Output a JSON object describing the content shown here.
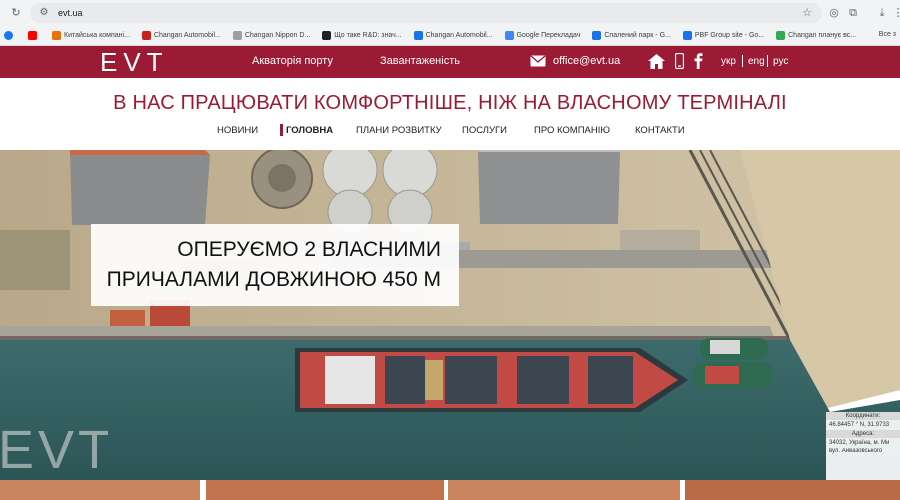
{
  "browser": {
    "url": "evt.ua",
    "bookmarks": [
      {
        "label": "Китайська компані...",
        "color": "#e8710a"
      },
      {
        "label": "Changan Automobil...",
        "color": "#c5221f"
      },
      {
        "label": "Changan Nippon D...",
        "color": "#9aa0a6"
      },
      {
        "label": "Що таке R&D: знач...",
        "color": "#202124"
      },
      {
        "label": "Changan Automobil...",
        "color": "#1a73e8"
      },
      {
        "label": "Google Перекладач",
        "color": "#4285f4"
      },
      {
        "label": "Спалений парк - G...",
        "color": "#1a73e8"
      },
      {
        "label": "PBF Group site - Go...",
        "color": "#1a73e8"
      },
      {
        "label": "Changan планує вс...",
        "color": "#34a853"
      }
    ],
    "bookmarks_more": "Все з"
  },
  "header": {
    "logo_text": "EVT",
    "nav": [
      "Акваторія порту",
      "Завантаженість"
    ],
    "email": "office@evt.ua",
    "languages": [
      "укр",
      "eng",
      "рус"
    ],
    "brand_color": "#9c1b34"
  },
  "slogan": "В НАС ПРАЦЮВАТИ КОМФОРТНІШЕ, НІЖ НА ВЛАСНОМУ ТЕРМІНАЛІ",
  "main_nav": [
    {
      "label": "НОВИНИ",
      "active": false
    },
    {
      "label": "ГОЛОВНА",
      "active": true
    },
    {
      "label": "ПЛАНИ РОЗВИТКУ",
      "active": false
    },
    {
      "label": "ПОСЛУГИ",
      "active": false
    },
    {
      "label": "ПРО КОМПАНІЮ",
      "active": false
    },
    {
      "label": "КОНТАКТИ",
      "active": false
    }
  ],
  "hero": {
    "caption_line1": "ОПЕРУЄМО 2 ВЛАСНИМИ",
    "caption_line2": "ПРИЧАЛАМИ ДОВЖИНОЮ 450 М",
    "watermark": "EVT",
    "coords": {
      "label": "Координати:",
      "value": "46.84457 ° N, 31.9733",
      "address_label": "Адреса:",
      "address_line1": "34032, Україна, м. Ми",
      "address_line2": "вул. Айвазовського"
    }
  },
  "tiles": [
    {
      "color": "#c98560"
    },
    {
      "color": "#c1734d"
    },
    {
      "color": "#c98560"
    },
    {
      "color": "#b96a46"
    }
  ]
}
